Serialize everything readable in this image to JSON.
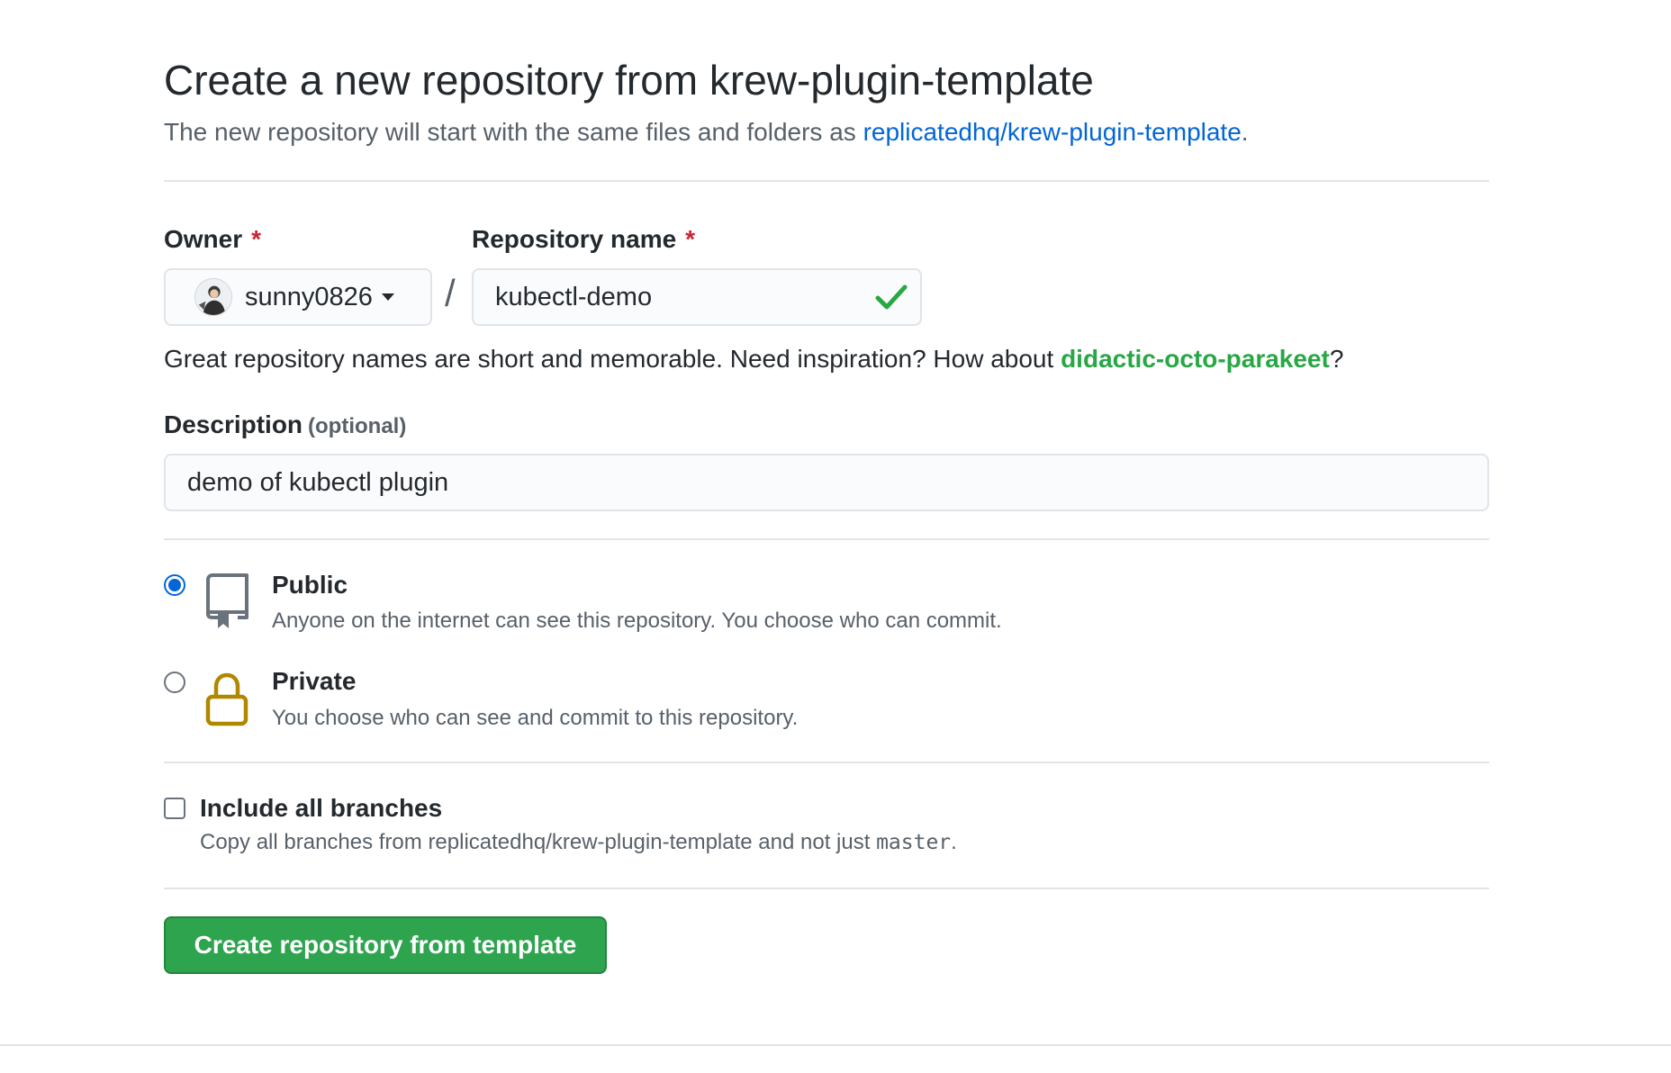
{
  "header": {
    "title": "Create a new repository from krew-plugin-template",
    "subtitle_prefix": "The new repository will start with the same files and folders as ",
    "template_link": "replicatedhq/krew-plugin-template",
    "subtitle_suffix": "."
  },
  "owner": {
    "label": "Owner",
    "required_mark": "*",
    "selected": "sunny0826"
  },
  "repo_name": {
    "label": "Repository name",
    "required_mark": "*",
    "value": "kubectl-demo",
    "status_icon": "check-icon",
    "status_color": "#28a745"
  },
  "hint": {
    "prefix": "Great repository names are short and memorable. Need inspiration? How about ",
    "suggestion": "didactic-octo-parakeet",
    "suffix": "?"
  },
  "description": {
    "label": "Description",
    "optional": "(optional)",
    "value": "demo of kubectl plugin"
  },
  "visibility": {
    "selected": "public",
    "options": [
      {
        "id": "public",
        "title": "Public",
        "description": "Anyone on the internet can see this repository. You choose who can commit.",
        "icon": "repo-icon",
        "icon_color": "#6a737d"
      },
      {
        "id": "private",
        "title": "Private",
        "description": "You choose who can see and commit to this repository.",
        "icon": "lock-icon",
        "icon_color": "#b08800"
      }
    ]
  },
  "branches": {
    "label": "Include all branches",
    "checked": false,
    "description_prefix": "Copy all branches from replicatedhq/krew-plugin-template and not just ",
    "branch": "master",
    "description_suffix": "."
  },
  "submit": {
    "label": "Create repository from template",
    "color": "#2ea44f"
  },
  "colors": {
    "link": "#0366d6",
    "required": "#cb2431",
    "accent": "#0366d6"
  }
}
